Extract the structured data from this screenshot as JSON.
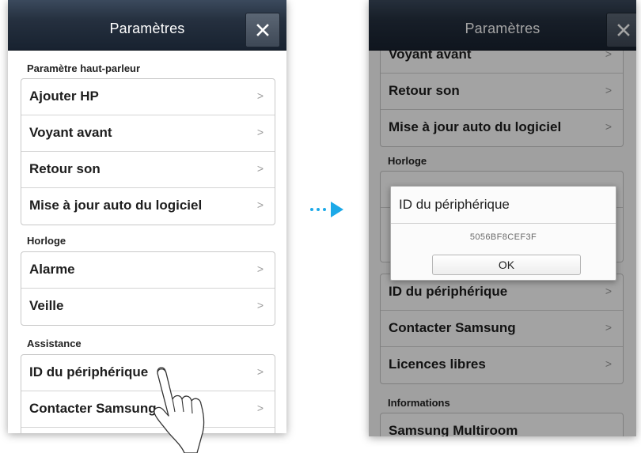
{
  "left_screen": {
    "title": "Paramètres",
    "sections": [
      {
        "header": "Paramètre haut-parleur",
        "items": [
          "Ajouter HP",
          "Voyant avant",
          "Retour son",
          "Mise à jour auto du logiciel"
        ]
      },
      {
        "header": "Horloge",
        "items": [
          "Alarme",
          "Veille"
        ]
      },
      {
        "header": "Assistance",
        "items": [
          "ID du périphérique",
          "Contacter Samsung"
        ]
      }
    ]
  },
  "right_screen": {
    "title": "Paramètres",
    "items_top": [
      "Voyant avant",
      "Retour son",
      "Mise à jour auto du logiciel"
    ],
    "section_clock": "Horloge",
    "items_assist": [
      "ID du périphérique",
      "Contacter Samsung",
      "Licences libres"
    ],
    "section_info": "Informations",
    "partial_item": "Samsung Multiroom",
    "dialog": {
      "title": "ID du périphérique",
      "value": "5056BF8CEF3F",
      "ok_label": "OK"
    }
  },
  "icons": {
    "close": "close-icon",
    "chevron": "chevron-right-icon",
    "arrow": "arrow-right-icon",
    "hand": "hand-pointer-icon"
  },
  "chevron_glyph": ">",
  "colors": {
    "titlebar": "#25303f",
    "accent_arrow": "#1ca9e8"
  }
}
